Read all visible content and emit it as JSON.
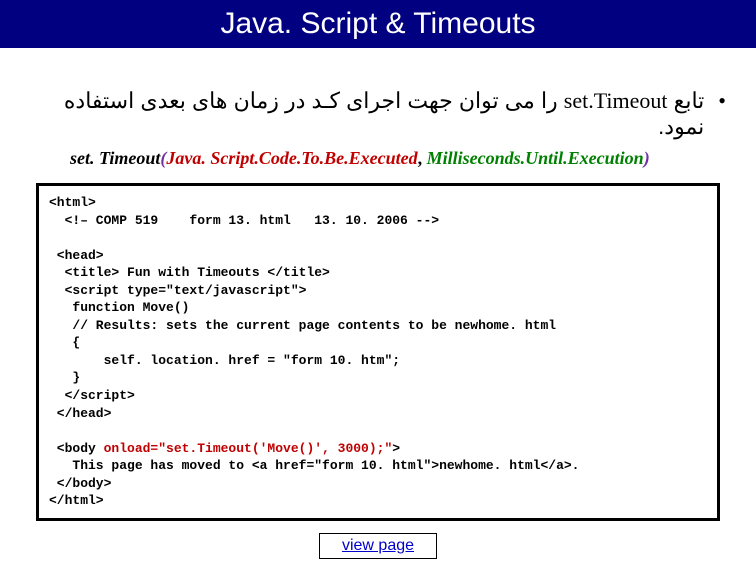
{
  "title": "Java. Script & Timeouts",
  "bullet": {
    "func": "set.Timeout",
    "label_pre": "تابع ",
    "label_post": " را می توان جهت اجرای کـد در زمان های بعدی استفاده نمود."
  },
  "signature": {
    "name": "set. Timeout",
    "p_open": "(",
    "arg1": "Java. Script.Code.To.Be.Executed",
    "comma": ", ",
    "arg2": "Milliseconds.Until.Execution",
    "p_close": ")"
  },
  "code": {
    "l1": "<html>",
    "l2": "  <!– COMP 519    form 13. html   13. 10. 2006 -->",
    "l3": "",
    "l4": " <head>",
    "l5": "  <title> Fun with Timeouts </title>",
    "l6": "  <script type=\"text/javascript\">",
    "l7": "   function Move()",
    "l8": "   // Results: sets the current page contents to be newhome. html",
    "l9": "   {",
    "l10": "       self. location. href = \"form 10. htm\";",
    "l11": "   }",
    "l12": "  </scr",
    "l12b": "ipt>",
    "l13": " </head>",
    "l14": "",
    "l15a": " <body ",
    "l15b": "onload=\"set.Timeout('Move()', 3000);\"",
    "l15c": ">",
    "l16": "   This page has moved to <a href=\"form 10. html\">newhome. html</a>.",
    "l17": " </body>",
    "l18": "</html>"
  },
  "link": {
    "label": "view page"
  }
}
